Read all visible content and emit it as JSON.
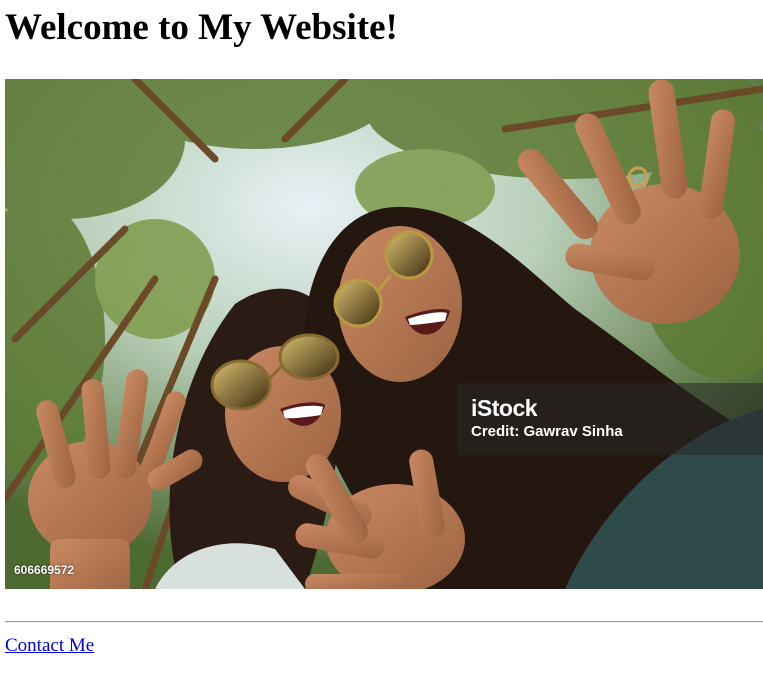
{
  "page": {
    "title": "Welcome to My Website!"
  },
  "hero_image": {
    "description_icon": "photo-two-women-waving",
    "watermark_brand": "iStock",
    "watermark_credit": "Credit: Gawrav Sinha",
    "image_id": "606669572"
  },
  "footer": {
    "contact_label": "Contact Me",
    "link_color": "#0000ee"
  }
}
